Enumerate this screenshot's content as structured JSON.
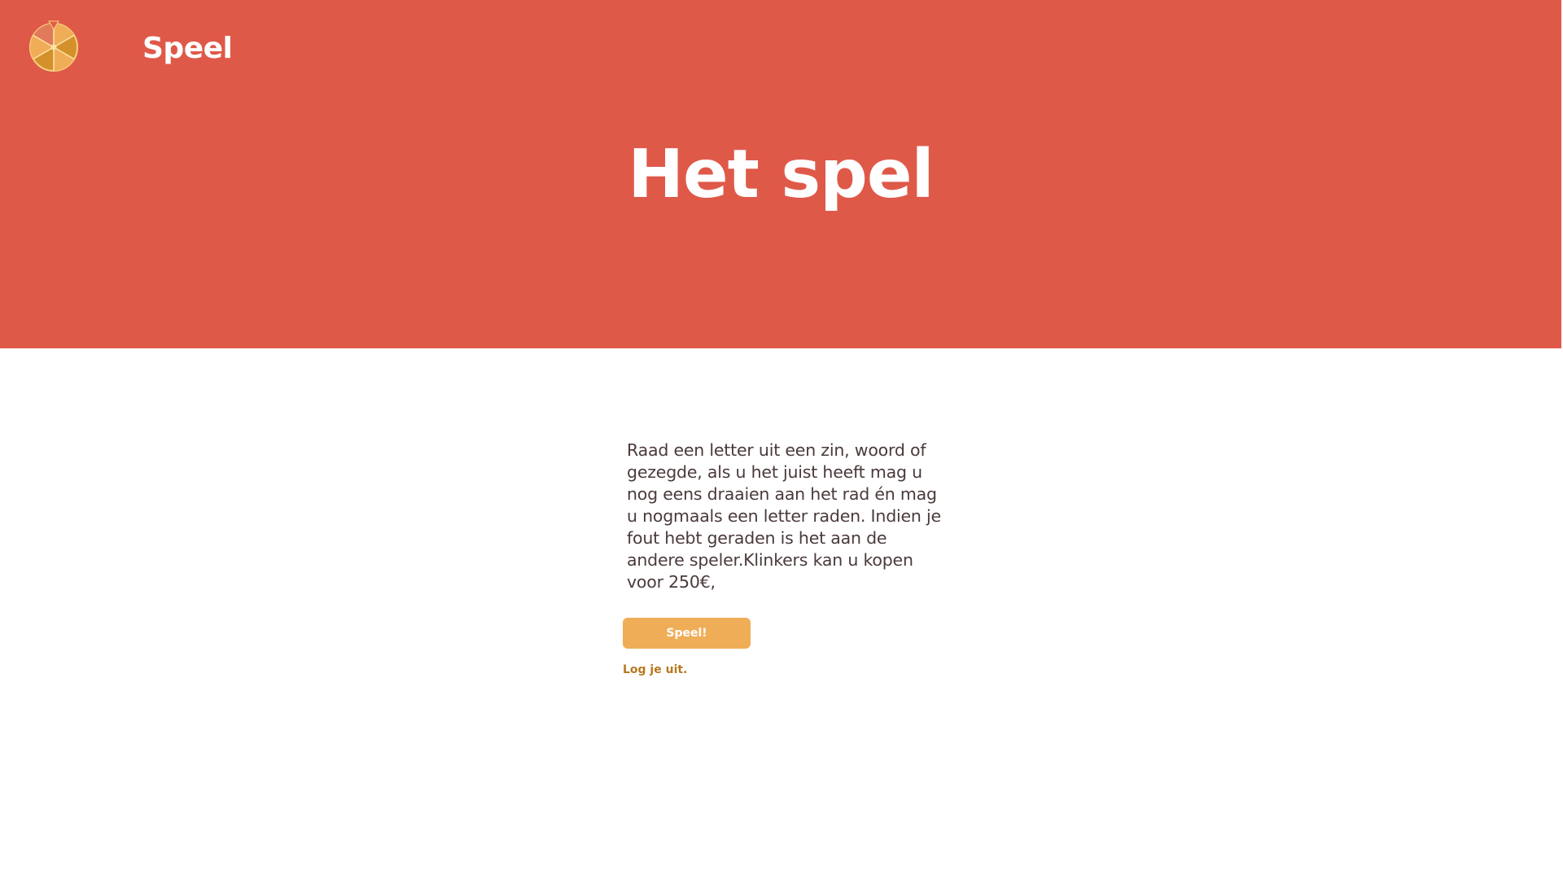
{
  "header": {
    "site_title": "Speel",
    "logo_icon": "wheel-of-fortune-icon"
  },
  "hero": {
    "heading": "Het spel",
    "background_color": "#df5949"
  },
  "main": {
    "description": "Raad een letter uit een zin, woord of gezegde, als u het juist heeft mag u nog eens draaien aan het rad én mag u nogmaals een letter raden.  Indien je fout hebt geraden is het aan de andere speler.Klinkers kan u kopen voor 250€,",
    "play_button_label": "Speel!",
    "logout_link_label": "Log je uit."
  },
  "colors": {
    "accent": "#f0ad57",
    "link": "#b7791f",
    "text": "#4a3a3a"
  }
}
